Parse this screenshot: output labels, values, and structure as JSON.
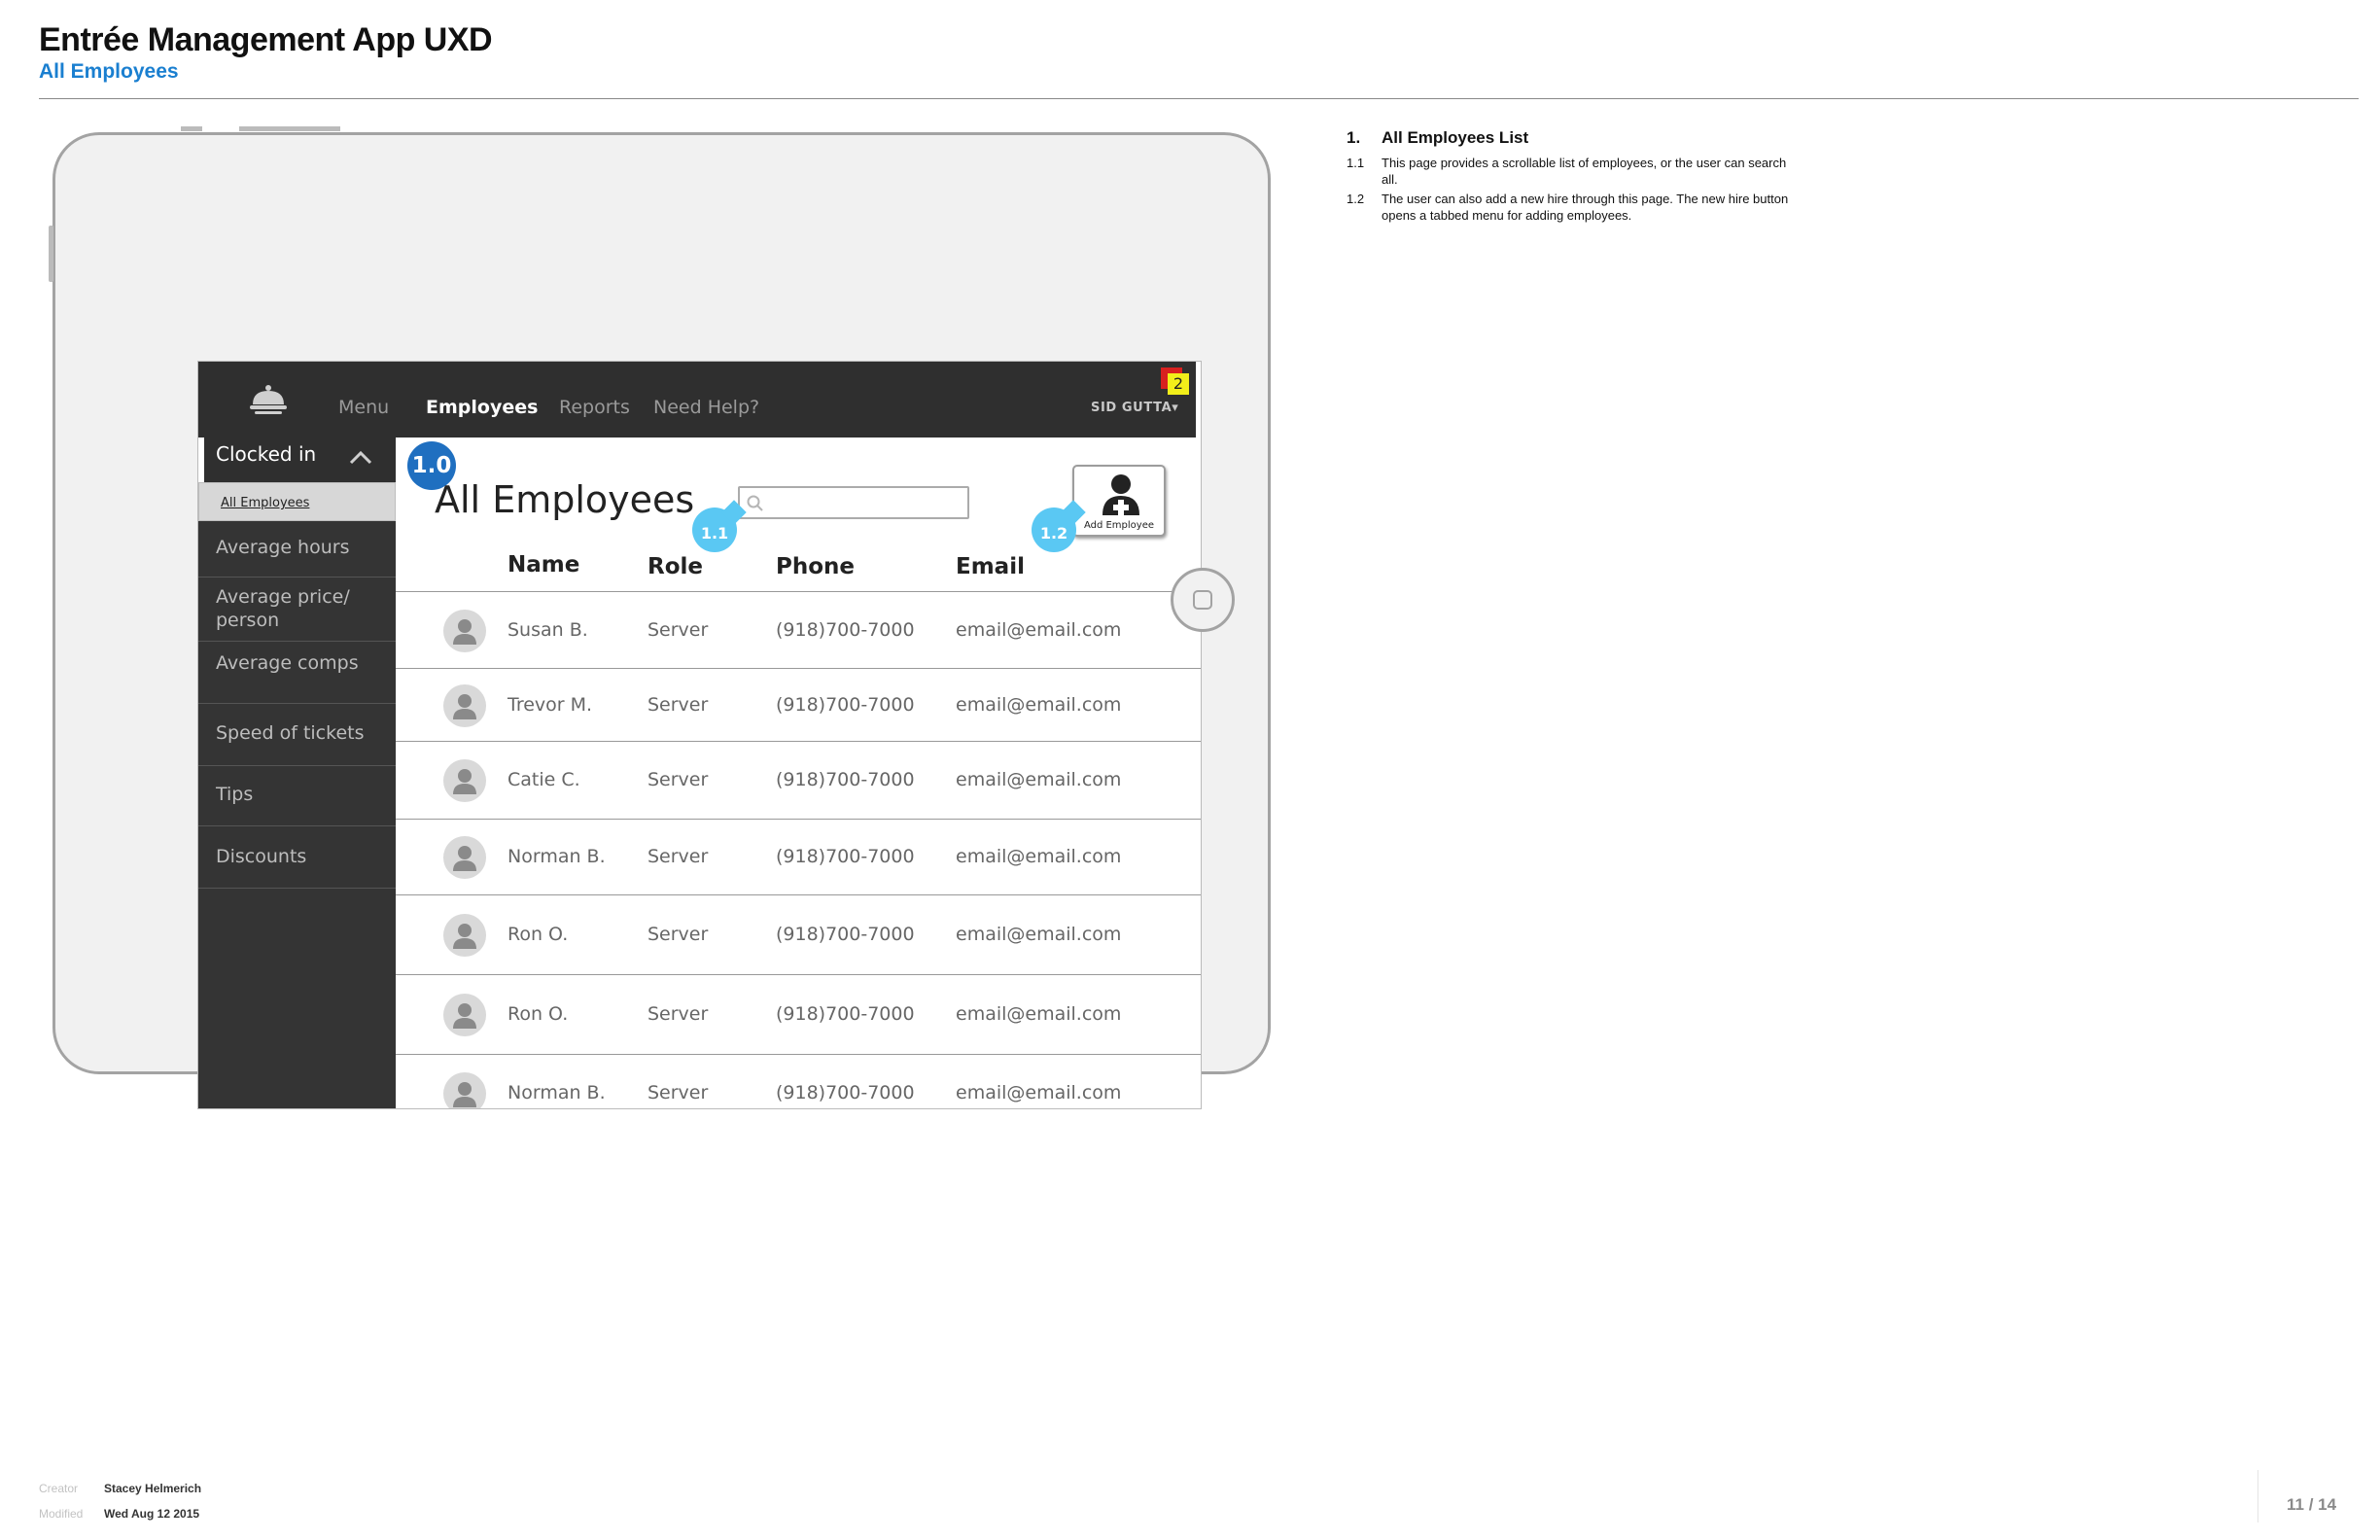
{
  "document": {
    "title": "Entrée Management App UXD",
    "subtitle": "All Employees"
  },
  "app": {
    "nav": {
      "items": [
        "Menu",
        "Employees",
        "Reports",
        "Need Help?"
      ],
      "active": "Employees",
      "user": "SID GUTTA",
      "notification_count": "2"
    },
    "sidebar": {
      "header": "Clocked in",
      "selected": "All Employees",
      "items": [
        "Average hours",
        "Average price/ person",
        "Average comps",
        "Speed of tickets",
        "Tips",
        "Discounts"
      ]
    },
    "main": {
      "title": "All Employees",
      "search": {
        "placeholder": "",
        "value": ""
      },
      "add_button": "Add Employee",
      "columns": [
        "Name",
        "Role",
        "Phone",
        "Email"
      ],
      "employees": [
        {
          "name": "Susan B.",
          "role": "Server",
          "phone": "(918)700-7000",
          "email": "email@email.com"
        },
        {
          "name": "Trevor M.",
          "role": "Server",
          "phone": "(918)700-7000",
          "email": "email@email.com"
        },
        {
          "name": "Catie C.",
          "role": "Server",
          "phone": "(918)700-7000",
          "email": "email@email.com"
        },
        {
          "name": "Norman B.",
          "role": "Server",
          "phone": "(918)700-7000",
          "email": "email@email.com"
        },
        {
          "name": "Ron O.",
          "role": "Server",
          "phone": "(918)700-7000",
          "email": "email@email.com"
        },
        {
          "name": "Ron O.",
          "role": "Server",
          "phone": "(918)700-7000",
          "email": "email@email.com"
        },
        {
          "name": "Norman B.",
          "role": "Server",
          "phone": "(918)700-7000",
          "email": "email@email.com"
        }
      ]
    },
    "annotations": {
      "m1_0": "1.0",
      "m1_1": "1.1",
      "m1_2": "1.2"
    }
  },
  "notes": {
    "heading_num": "1.",
    "heading": "All Employees List",
    "items": [
      {
        "num": "1.1",
        "text": "This page provides a scrollable list of employees, or the user can search all."
      },
      {
        "num": "1.2",
        "text": "The user can also add a new hire through this page. The new hire button opens a tabbed menu for adding employees."
      }
    ]
  },
  "footer": {
    "creator_label": "Creator",
    "creator": "Stacey Helmerich",
    "modified_label": "Modified",
    "modified": "Wed Aug 12 2015",
    "page": "11 / 14"
  },
  "colors": {
    "header_blue": "#1a7fd0",
    "marker_blue": "#1f6fc0",
    "marker_light": "#5ac8f3",
    "nav_bg": "#2f2f2f",
    "badge_yellow": "#f2ee1a",
    "badge_red": "#d8201f"
  }
}
